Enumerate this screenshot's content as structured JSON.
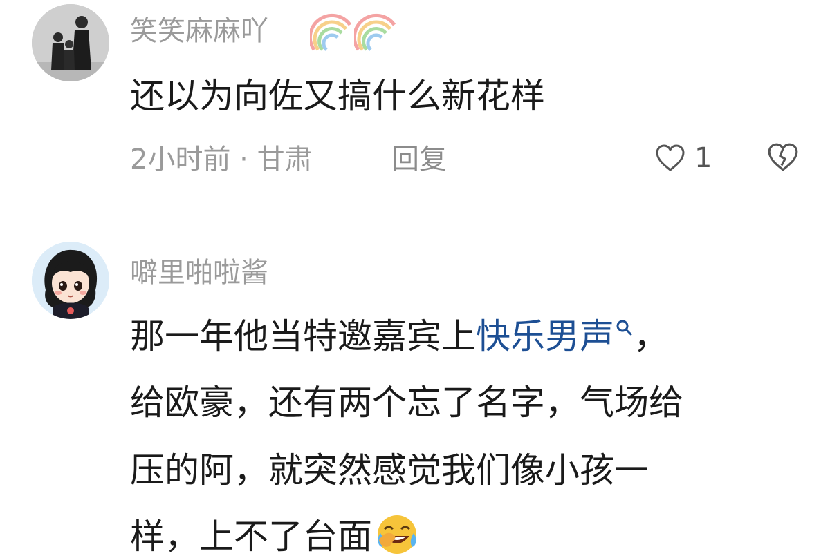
{
  "comments": [
    {
      "username": "笑笑麻麻吖",
      "text": "还以为向佐又搞什么新花样",
      "meta": "2小时前 · 甘肃",
      "reply_label": "回复",
      "like_count": "1"
    },
    {
      "username": "噼里啪啦酱",
      "lines": {
        "l1_before": "那一年他当特邀嘉宾上",
        "l1_link": "快乐男声",
        "l1_after": "，",
        "l2": "给欧豪，还有两个忘了名字，气场给",
        "l3": "压的阿，就突然感觉我们像小孩一",
        "l4": "样，上不了台面"
      }
    }
  ],
  "colors": {
    "username": "#9a9a9a",
    "text": "#1a1a1a",
    "link": "#1d4f94",
    "meta": "#9a9a9a"
  },
  "icons": {
    "rainbow": "rainbow-icon",
    "like": "heart-icon",
    "dislike": "broken-heart-icon",
    "search": "search-icon",
    "emoji": "laughing-crying-emoji"
  }
}
